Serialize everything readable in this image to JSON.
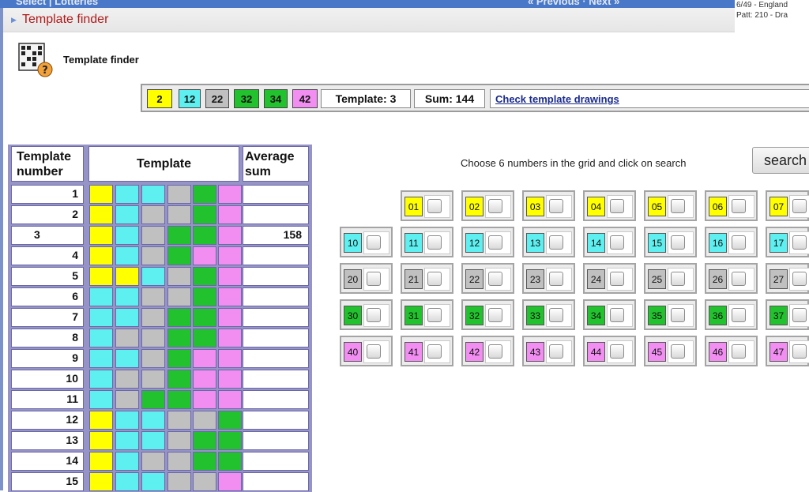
{
  "header": {
    "cut_left": "Select | Lotteries",
    "cut_right": "« Previous · Next »",
    "right_line1": "6/49 - England",
    "right_line2": "Patt: 210 - Dra"
  },
  "breadcrumb": {
    "label": "Template finder"
  },
  "app": {
    "title": "Template finder",
    "icon": "template-grid-question-icon"
  },
  "selection": {
    "numbers": [
      {
        "value": "2",
        "color": "#ffff00"
      },
      {
        "value": "12",
        "color": "#5ef0f0"
      },
      {
        "value": "22",
        "color": "#c0c0c0"
      },
      {
        "value": "32",
        "color": "#22c22e"
      },
      {
        "value": "34",
        "color": "#22c22e"
      },
      {
        "value": "42",
        "color": "#f28ef2"
      }
    ],
    "template_label": "Template: 3",
    "sum_label": "Sum: 144",
    "check_link": "Check template drawings"
  },
  "template_table": {
    "headers": {
      "number": "Template number",
      "template": "Template",
      "avg": "Average sum"
    },
    "colors": {
      "Y": "#ffff00",
      "C": "#5ef0f0",
      "G": "#c0c0c0",
      "N": "#22c22e",
      "P": "#f28ef2"
    },
    "rows": [
      {
        "num": "1",
        "cells": "YCCGNP",
        "avg": ""
      },
      {
        "num": "2",
        "cells": "YCGGNP",
        "avg": ""
      },
      {
        "num": "3",
        "cells": "YCGNNP",
        "avg": "158"
      },
      {
        "num": "4",
        "cells": "YCGNPP",
        "avg": ""
      },
      {
        "num": "5",
        "cells": "YYCGNP",
        "avg": ""
      },
      {
        "num": "6",
        "cells": "CCGGNP",
        "avg": ""
      },
      {
        "num": "7",
        "cells": "CCGNNP",
        "avg": ""
      },
      {
        "num": "8",
        "cells": "CGGNNP",
        "avg": ""
      },
      {
        "num": "9",
        "cells": "CCGNPP",
        "avg": ""
      },
      {
        "num": "10",
        "cells": "CGGNPP",
        "avg": ""
      },
      {
        "num": "11",
        "cells": "CGNNPP",
        "avg": ""
      },
      {
        "num": "12",
        "cells": "YCCGGN",
        "avg": ""
      },
      {
        "num": "13",
        "cells": "YCCGNN",
        "avg": ""
      },
      {
        "num": "14",
        "cells": "YCGGNN",
        "avg": ""
      },
      {
        "num": "15",
        "cells": "YCCGGP",
        "avg": ""
      }
    ]
  },
  "grid": {
    "instruction": "Choose 6 numbers in the grid and click on search",
    "search_label": "search",
    "rows": [
      {
        "color": "#ffff00",
        "numbers": [
          "01",
          "02",
          "03",
          "04",
          "05",
          "06",
          "07"
        ]
      },
      {
        "color": "#5ef0f0",
        "numbers": [
          "10",
          "11",
          "12",
          "13",
          "14",
          "15",
          "16",
          "17"
        ]
      },
      {
        "color": "#c0c0c0",
        "numbers": [
          "20",
          "21",
          "22",
          "23",
          "24",
          "25",
          "26",
          "27"
        ]
      },
      {
        "color": "#22c22e",
        "numbers": [
          "30",
          "31",
          "32",
          "33",
          "34",
          "35",
          "36",
          "37"
        ]
      },
      {
        "color": "#f28ef2",
        "numbers": [
          "40",
          "41",
          "42",
          "43",
          "44",
          "45",
          "46",
          "47"
        ]
      }
    ]
  }
}
